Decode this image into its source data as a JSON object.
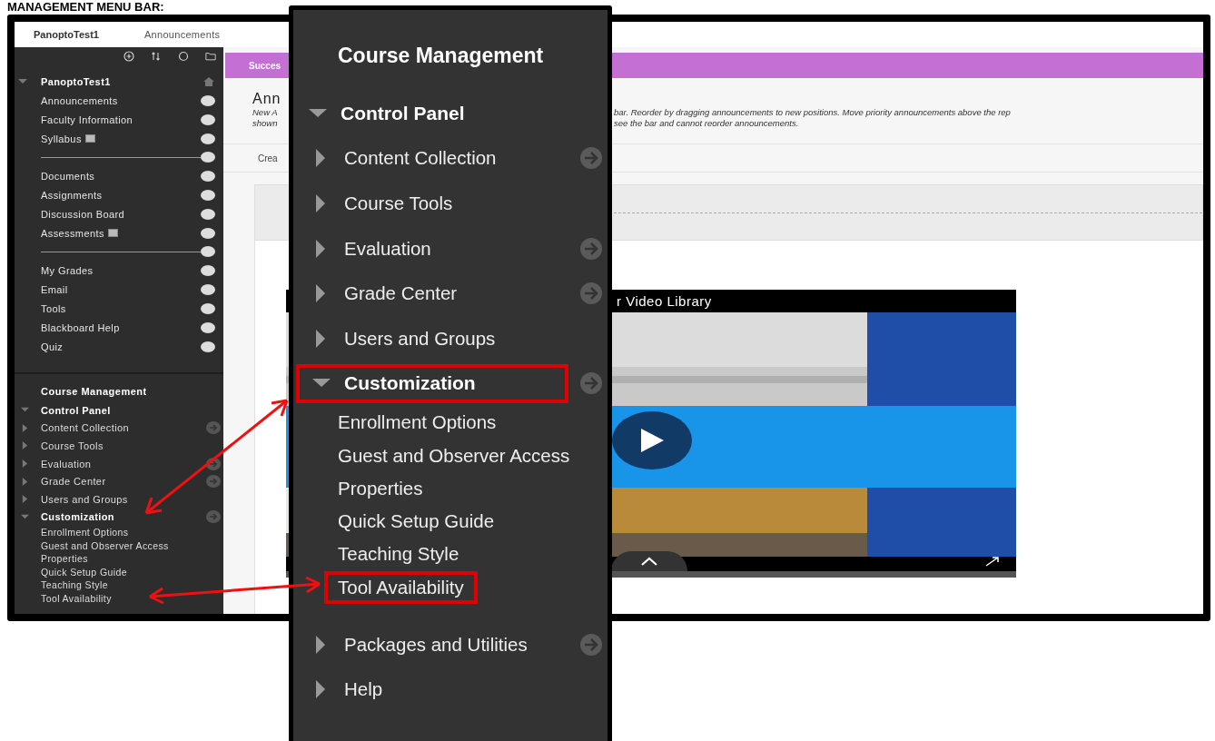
{
  "heading": "MANAGEMENT MENU BAR:",
  "top_bar": {
    "course": "PanoptoTest1",
    "page": "Announcements"
  },
  "sidebar": {
    "course_title": "PanoptoTest1",
    "groups": [
      [
        {
          "label": "Announcements",
          "marked": false
        },
        {
          "label": "Faculty Information",
          "marked": false
        },
        {
          "label": "Syllabus",
          "marked": true
        }
      ],
      [
        {
          "label": "Documents",
          "marked": false
        },
        {
          "label": "Assignments",
          "marked": false
        },
        {
          "label": "Discussion Board",
          "marked": false
        },
        {
          "label": "Assessments",
          "marked": true
        }
      ],
      [
        {
          "label": "My Grades",
          "marked": false
        },
        {
          "label": "Email",
          "marked": false
        },
        {
          "label": "Tools",
          "marked": false
        },
        {
          "label": "Blackboard Help",
          "marked": false
        },
        {
          "label": "Quiz",
          "marked": false
        }
      ]
    ],
    "course_management": {
      "title": "Course Management",
      "control_panel": {
        "label": "Control Panel",
        "expanded": true
      },
      "items": [
        {
          "label": "Content Collection",
          "expanded": false,
          "has_link": true
        },
        {
          "label": "Course Tools",
          "expanded": false,
          "has_link": false
        },
        {
          "label": "Evaluation",
          "expanded": false,
          "has_link": true
        },
        {
          "label": "Grade Center",
          "expanded": false,
          "has_link": true
        },
        {
          "label": "Users and Groups",
          "expanded": false,
          "has_link": false
        },
        {
          "label": "Customization",
          "expanded": true,
          "has_link": true,
          "children": [
            {
              "label": "Enrollment Options"
            },
            {
              "label": "Guest and Observer Access"
            },
            {
              "label": "Properties"
            },
            {
              "label": "Quick Setup Guide"
            },
            {
              "label": "Teaching Style"
            },
            {
              "label": "Tool Availability"
            }
          ]
        }
      ]
    }
  },
  "main": {
    "banner": "Succes",
    "title": "Ann",
    "description_left": [
      "New A",
      "shown"
    ],
    "description_right": [
      "bar. Reorder by dragging announcements to new positions. Move priority announcements above the rep",
      "see the bar and cannot reorder announcements."
    ],
    "toolbar_item": "Crea",
    "video_title": "r Video Library"
  },
  "zoom_callout": {
    "title": "Course Management",
    "control_panel": {
      "label": "Control Panel",
      "expanded": true
    },
    "items": [
      {
        "label": "Content Collection",
        "expanded": false,
        "has_link": true,
        "highlighted": false
      },
      {
        "label": "Course Tools",
        "expanded": false,
        "has_link": false,
        "highlighted": false
      },
      {
        "label": "Evaluation",
        "expanded": false,
        "has_link": true,
        "highlighted": false
      },
      {
        "label": "Grade Center",
        "expanded": false,
        "has_link": true,
        "highlighted": false
      },
      {
        "label": "Users and Groups",
        "expanded": false,
        "has_link": false,
        "highlighted": false
      },
      {
        "label": "Customization",
        "expanded": true,
        "has_link": true,
        "highlighted": true,
        "children": [
          {
            "label": "Enrollment Options",
            "highlighted": false
          },
          {
            "label": "Guest and Observer Access",
            "highlighted": false
          },
          {
            "label": "Properties",
            "highlighted": false
          },
          {
            "label": "Quick Setup Guide",
            "highlighted": false
          },
          {
            "label": "Teaching Style",
            "highlighted": false
          },
          {
            "label": "Tool Availability",
            "highlighted": true
          }
        ]
      },
      {
        "label": "Packages and Utilities",
        "expanded": false,
        "has_link": true,
        "highlighted": false
      },
      {
        "label": "Help",
        "expanded": false,
        "has_link": false,
        "highlighted": false
      }
    ]
  }
}
